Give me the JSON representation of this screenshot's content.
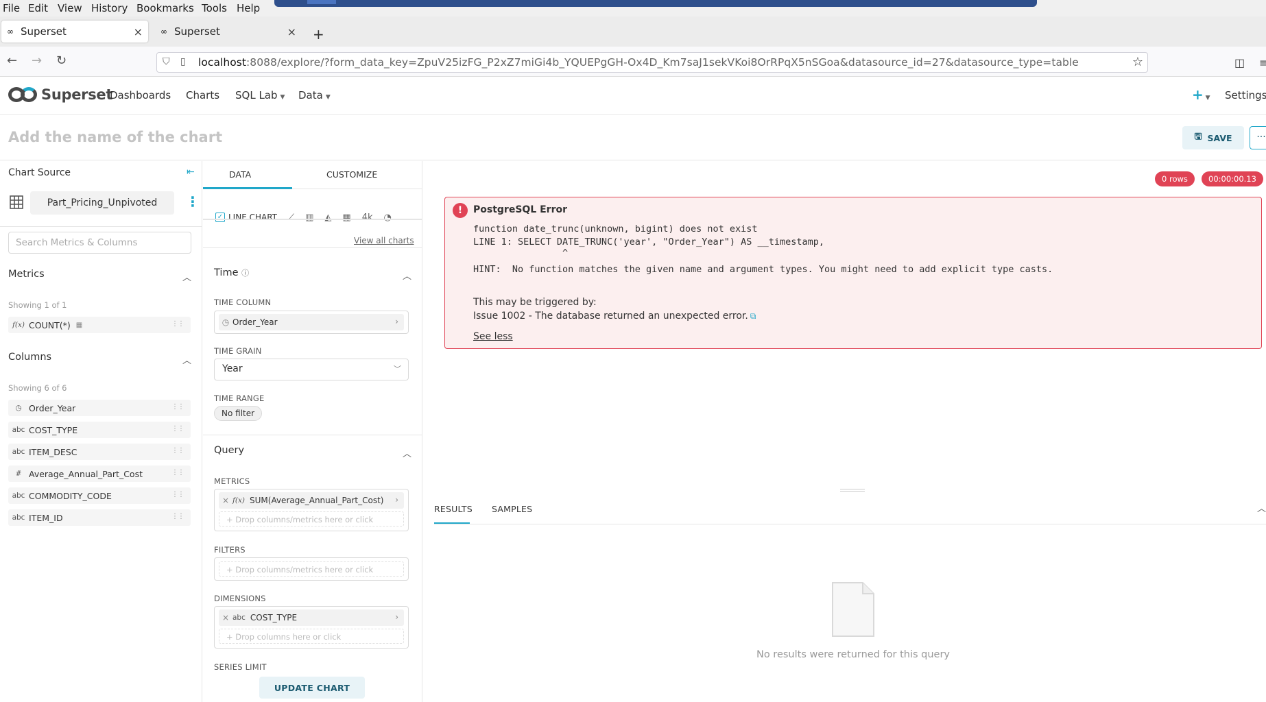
{
  "browser": {
    "menu": [
      "File",
      "Edit",
      "View",
      "History",
      "Bookmarks",
      "Tools",
      "Help"
    ],
    "tabs": [
      {
        "label": "Superset",
        "active": true
      },
      {
        "label": "Superset",
        "active": false
      }
    ],
    "new_tab": "+",
    "url_host": "localhost",
    "url_rest": ":8088/explore/?form_data_key=ZpuV25izFG_P2xZ7miGi4b_YQUEPgGH-Ox4D_Km7saJ1sekVKoi8OrRPqX5nSGoa&datasource_id=27&datasource_type=table"
  },
  "header": {
    "logo_text": "Superset",
    "nav": [
      "Dashboards",
      "Charts",
      "SQL Lab",
      "Data"
    ],
    "plus": "+",
    "settings": "Settings"
  },
  "chart": {
    "title_placeholder": "Add the name of the chart",
    "save_label": "SAVE",
    "more_label": "···"
  },
  "datasource": {
    "header": "Chart Source",
    "name": "Part_Pricing_Unpivoted",
    "search_placeholder": "Search Metrics & Columns",
    "metrics_header": "Metrics",
    "metrics_showing": "Showing 1 of 1",
    "metrics": [
      {
        "type": "f(x)",
        "name": "COUNT(*)"
      }
    ],
    "columns_header": "Columns",
    "columns_showing": "Showing 6 of 6",
    "columns": [
      {
        "type": "clock",
        "name": "Order_Year"
      },
      {
        "type": "abc",
        "name": "COST_TYPE"
      },
      {
        "type": "abc",
        "name": "ITEM_DESC"
      },
      {
        "type": "#",
        "name": "Average_Annual_Part_Cost"
      },
      {
        "type": "abc",
        "name": "COMMODITY_CODE"
      },
      {
        "type": "abc",
        "name": "ITEM_ID"
      }
    ]
  },
  "controls": {
    "tab_data": "DATA",
    "tab_customize": "CUSTOMIZE",
    "viz_type": "LINE CHART",
    "viz_4k": "4k",
    "view_all": "View all charts",
    "time_header": "Time",
    "time_column_label": "TIME COLUMN",
    "time_column_value": "Order_Year",
    "time_grain_label": "TIME GRAIN",
    "time_grain_value": "Year",
    "time_range_label": "TIME RANGE",
    "time_range_value": "No filter",
    "query_header": "Query",
    "metrics_label": "METRICS",
    "metric_value": "SUM(Average_Annual_Part_Cost)",
    "metric_type": "f(x)",
    "drop_metrics": "Drop columns/metrics here or click",
    "filters_label": "FILTERS",
    "drop_filters": "Drop columns/metrics here or click",
    "dimensions_label": "DIMENSIONS",
    "dimension_type": "abc",
    "dimension_value": "COST_TYPE",
    "drop_columns": "Drop columns here or click",
    "series_limit_label": "SERIES LIMIT",
    "update_label": "UPDATE CHART"
  },
  "results": {
    "rows_badge": "0 rows",
    "time_badge": "00:00:00.13",
    "error_title": "PostgreSQL Error",
    "error_line1": "function date_trunc(unknown, bigint) does not exist",
    "error_line2": "LINE 1: SELECT DATE_TRUNC('year', \"Order_Year\") AS __timestamp,",
    "error_line3": "                ^",
    "error_hint": "HINT:  No function matches the given name and argument types. You might need to add explicit type casts.",
    "triggered_by": "This may be triggered by:",
    "issue": "Issue 1002 - The database returned an unexpected error.",
    "see_less": "See less",
    "tab_results": "RESULTS",
    "tab_samples": "SAMPLES",
    "empty_message": "No results were returned for this query"
  },
  "colors": {
    "accent": "#20a7c9",
    "error": "#e04355",
    "error_bg": "#fcefef"
  }
}
